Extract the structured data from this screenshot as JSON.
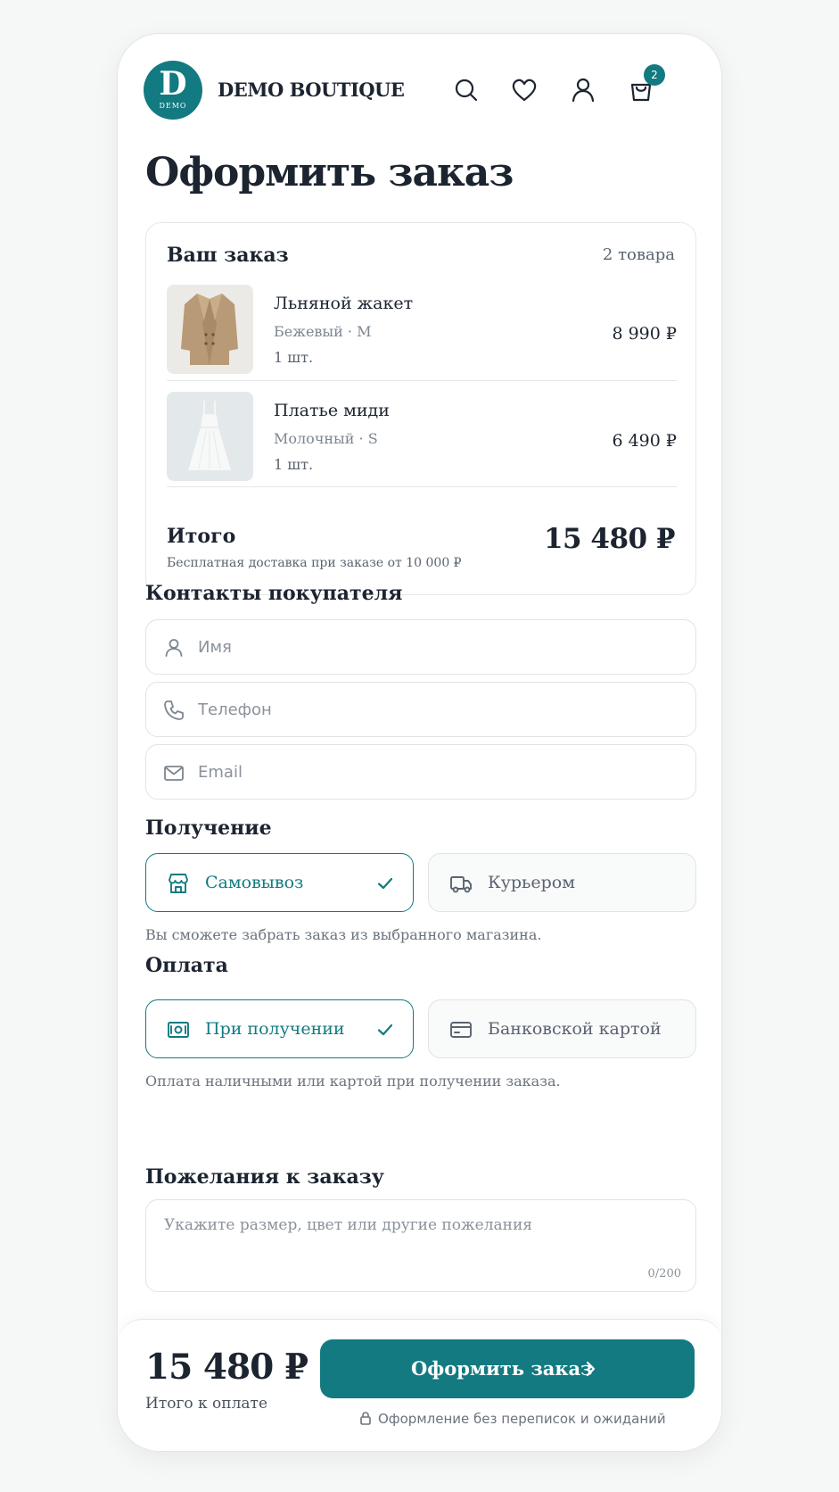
{
  "header": {
    "logo_letter": "D",
    "logo_sub": "DEMO",
    "brand": "DEMO BOUTIQUE",
    "cart_count": "2",
    "icons": [
      "search-icon",
      "heart-icon",
      "user-icon",
      "shopping-bag-icon"
    ]
  },
  "page": {
    "title": "Оформить заказ"
  },
  "order": {
    "title": "Ваш заказ",
    "count": "2 товара",
    "items": [
      {
        "name": "Льняной жакет",
        "variant": "Бежевый · M",
        "qty": "1 шт.",
        "price": "8 990 ₽"
      },
      {
        "name": "Платье миди",
        "variant": "Молочный · S",
        "qty": "1 шт.",
        "price": "6 490 ₽"
      }
    ],
    "total_label": "Итого",
    "total_note": "Бесплатная доставка при заказе от 10 000 ₽",
    "total_value": "15 480 ₽"
  },
  "contacts": {
    "title": "Контакты покупателя",
    "name_placeholder": "Имя",
    "phone_placeholder": "Телефон",
    "email_placeholder": "Email"
  },
  "delivery": {
    "title": "Получение",
    "options": [
      {
        "label": "Самовывоз",
        "selected": true
      },
      {
        "label": "Курьером",
        "selected": false
      }
    ],
    "hint": "Вы сможете забрать заказ из выбранного магазина."
  },
  "payment": {
    "title": "Оплата",
    "options": [
      {
        "label": "При получении",
        "selected": true
      },
      {
        "label": "Банковской картой",
        "selected": false
      }
    ],
    "hint": "Оплата наличными или картой при получении заказа."
  },
  "comment": {
    "title": "Пожелания к заказу",
    "placeholder": "Укажите размер, цвет или другие пожелания",
    "char_count": "0/200"
  },
  "bottom": {
    "total": "15 480 ₽",
    "total_label": "Итого к оплате",
    "cta_label": "Оформить заказ",
    "secure_note": "Оформление без переписок и ожиданий"
  },
  "colors": {
    "accent": "#127a80",
    "text": "#1c2430",
    "muted": "#6b737d"
  }
}
